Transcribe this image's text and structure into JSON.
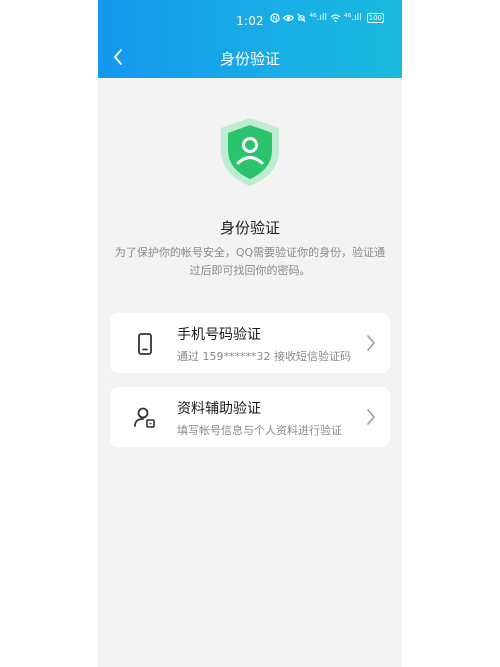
{
  "status": {
    "time": "1:02",
    "signal_1": "⁴⁶.ıll",
    "signal_2": "⁴⁶.ıll",
    "battery": "100"
  },
  "header": {
    "title": "身份验证"
  },
  "main": {
    "title": "身份验证",
    "description": "为了保护你的帐号安全，QQ需要验证你的身份，验证通过后即可找回你的密码。"
  },
  "options": [
    {
      "title": "手机号码验证",
      "subtitle": "通过 159******32 接收短信验证码",
      "icon": "phone-icon"
    },
    {
      "title": "资料辅助验证",
      "subtitle": "填写帐号信息与个人资料进行验证",
      "icon": "user-id-icon"
    }
  ],
  "colors": {
    "header_start": "#1597ee",
    "header_end": "#1ab9de",
    "shield_green": "#2bc46c",
    "background": "#f3f3f3"
  }
}
